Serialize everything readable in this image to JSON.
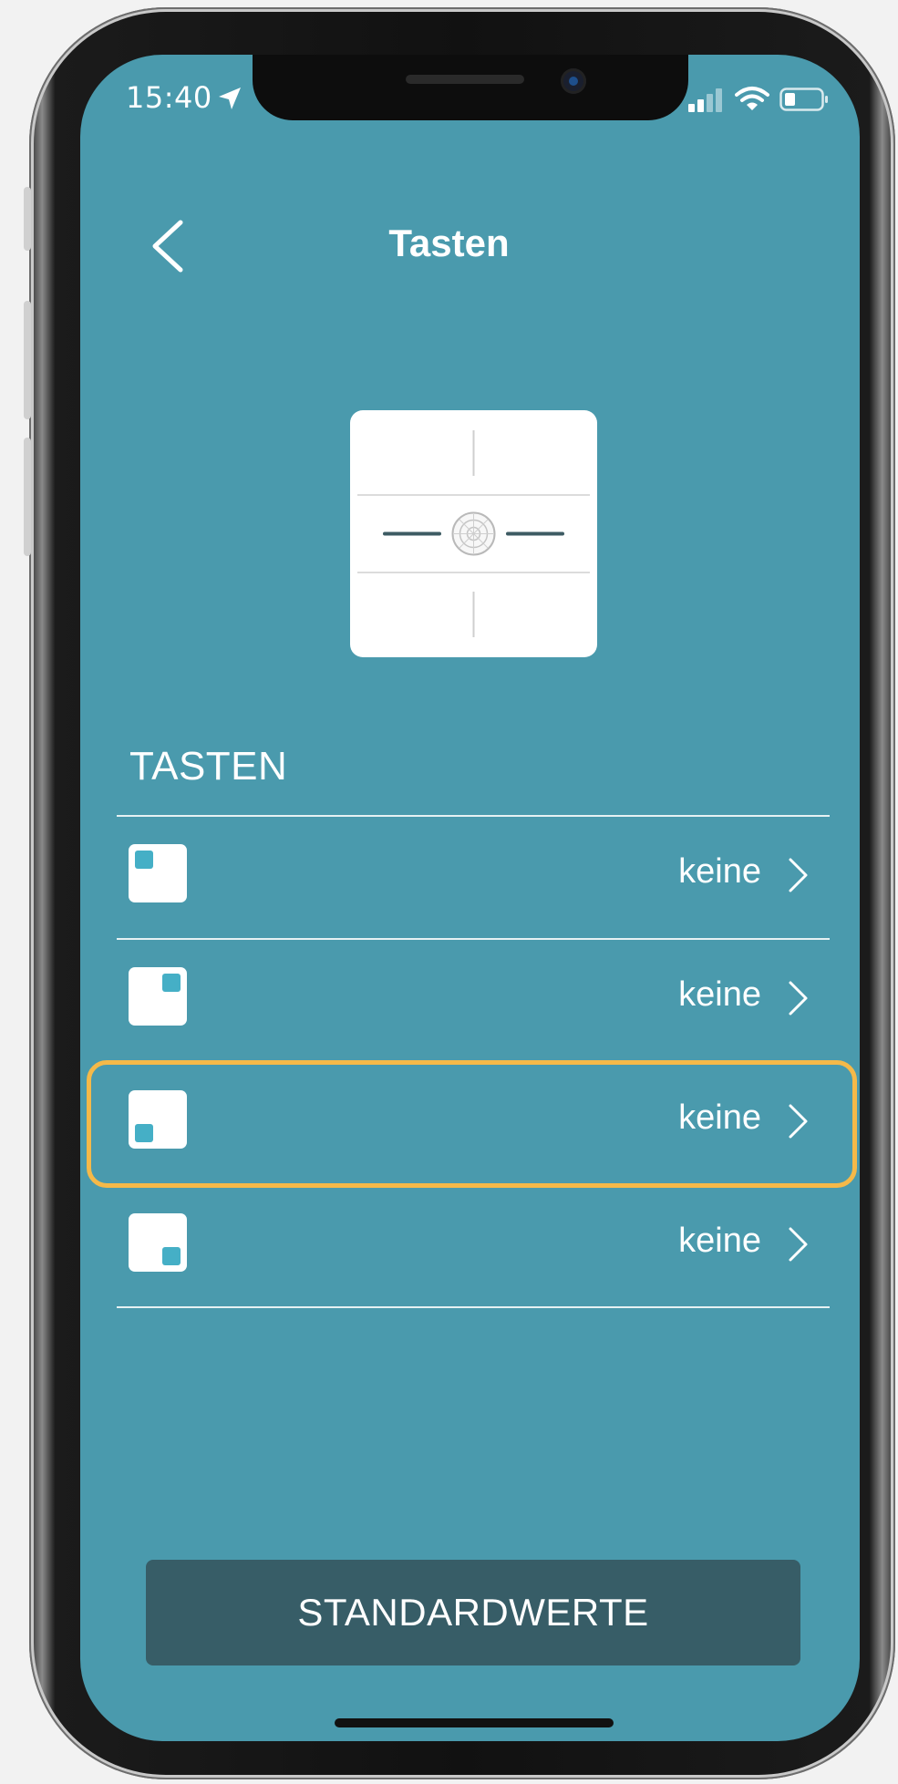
{
  "status_bar": {
    "time": "15:40"
  },
  "header": {
    "title": "Tasten",
    "back_icon": "chevron-left-icon"
  },
  "section": {
    "heading": "TASTEN"
  },
  "rows": [
    {
      "value": "keine",
      "position": "top-left"
    },
    {
      "value": "keine",
      "position": "top-right"
    },
    {
      "value": "keine",
      "position": "bottom-left",
      "highlighted": true
    },
    {
      "value": "keine",
      "position": "bottom-right"
    }
  ],
  "footer": {
    "defaults_label": "STANDARDWERTE"
  },
  "colors": {
    "screen_bg": "#4a9aad",
    "button_bg": "#375d67",
    "highlight": "#f5b949",
    "key_dot": "#45afc6"
  }
}
